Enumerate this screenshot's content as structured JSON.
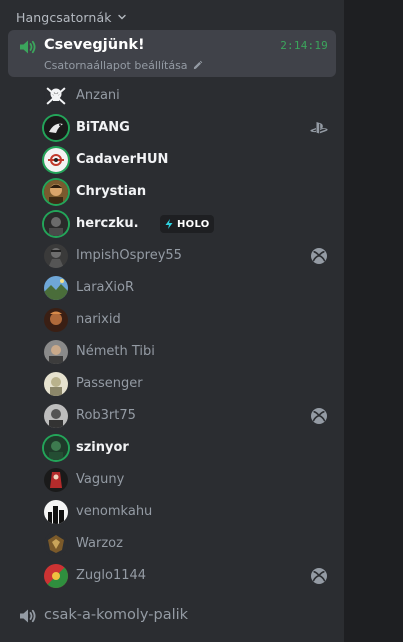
{
  "category": {
    "label": "Hangcsatornák"
  },
  "active_channel": {
    "name": "Csevegjünk!",
    "timer": "2:14:19",
    "status_text": "Csatornaállapot beállítása"
  },
  "users": [
    {
      "name": "Anzani",
      "bright": false,
      "speaking": false,
      "platform": null,
      "avatar": "skull"
    },
    {
      "name": "BiTANG",
      "bright": true,
      "speaking": true,
      "platform": "playstation",
      "avatar": "bird"
    },
    {
      "name": "CadaverHUN",
      "bright": true,
      "speaking": true,
      "platform": null,
      "avatar": "logo"
    },
    {
      "name": "Chrystian",
      "bright": true,
      "speaking": true,
      "platform": null,
      "avatar": "face"
    },
    {
      "name": "herczku.",
      "bright": true,
      "speaking": true,
      "platform": null,
      "avatar": "dark",
      "badge": "HOLO"
    },
    {
      "name": "ImpishOsprey55",
      "bright": false,
      "speaking": false,
      "platform": "xbox",
      "avatar": "soldier"
    },
    {
      "name": "LaraXioR",
      "bright": false,
      "speaking": false,
      "platform": null,
      "avatar": "landscape"
    },
    {
      "name": "narixid",
      "bright": false,
      "speaking": false,
      "platform": null,
      "avatar": "fire"
    },
    {
      "name": "Németh Tibi",
      "bright": false,
      "speaking": false,
      "platform": null,
      "avatar": "person"
    },
    {
      "name": "Passenger",
      "bright": false,
      "speaking": false,
      "platform": null,
      "avatar": "light"
    },
    {
      "name": "Rob3rt75",
      "bright": false,
      "speaking": false,
      "platform": "xbox",
      "avatar": "gray"
    },
    {
      "name": "szinyor",
      "bright": true,
      "speaking": true,
      "platform": null,
      "avatar": "green"
    },
    {
      "name": "Vaguny",
      "bright": false,
      "speaking": false,
      "platform": null,
      "avatar": "red"
    },
    {
      "name": "venomkahu",
      "bright": false,
      "speaking": false,
      "platform": null,
      "avatar": "city"
    },
    {
      "name": "Warzoz",
      "bright": false,
      "speaking": false,
      "platform": null,
      "avatar": "emblem"
    },
    {
      "name": "Zuglo1144",
      "bright": false,
      "speaking": false,
      "platform": "xbox",
      "avatar": "mixed"
    }
  ],
  "voice_channel": {
    "name": "csak-a-komoly-palik"
  },
  "colors": {
    "background": "#2b2d31",
    "active_bg": "#404249",
    "timer_green": "#3ba55c",
    "speaking_ring": "#23a559",
    "muted_text": "#949ba4",
    "bright_text": "#f2f3f5"
  }
}
